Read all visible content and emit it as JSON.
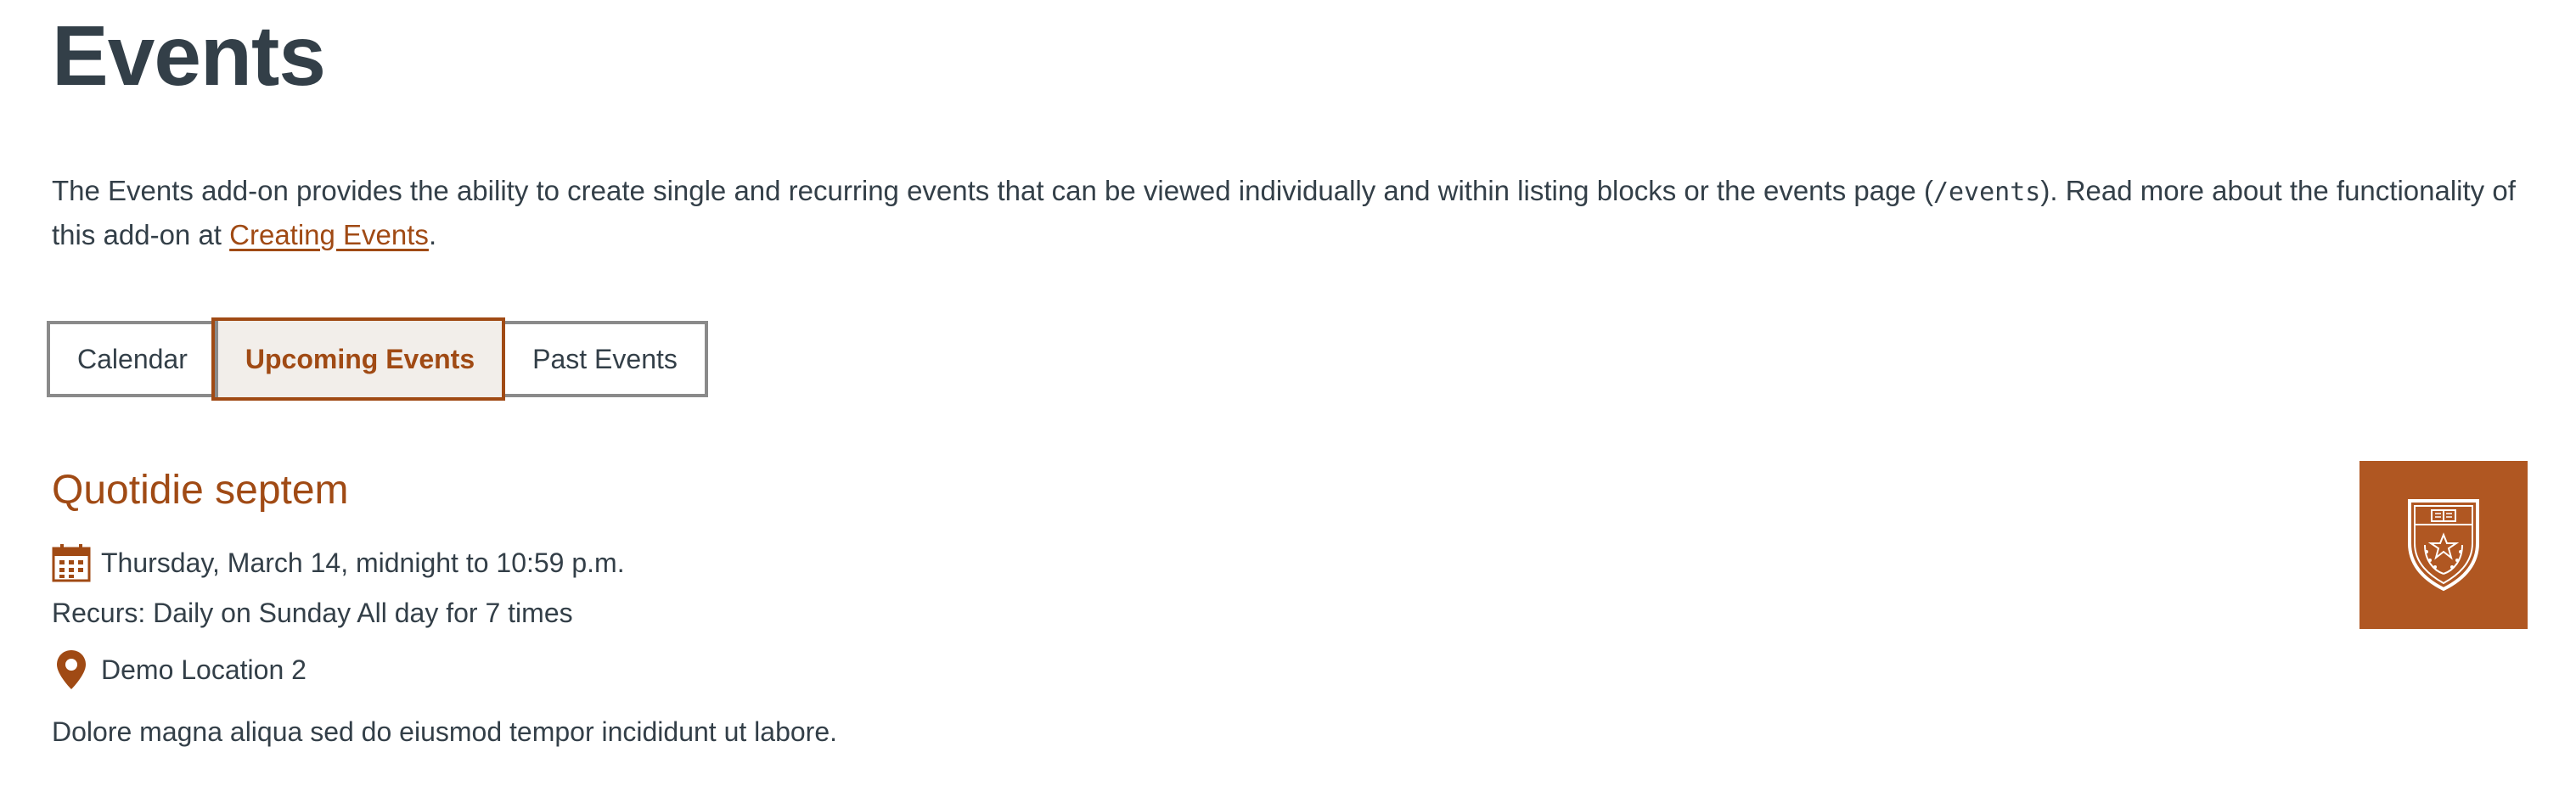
{
  "page": {
    "title": "Events"
  },
  "intro": {
    "text_before": "The Events add-on provides the ability to create single and recurring events that can be viewed individually and within listing blocks or the events page (",
    "code": "/events",
    "text_middle": "). Read more about the functionality of this add-on at ",
    "link_label": "Creating Events",
    "text_after": "."
  },
  "tabs": [
    {
      "label": "Calendar",
      "active": false
    },
    {
      "label": "Upcoming Events",
      "active": true
    },
    {
      "label": "Past Events",
      "active": false
    }
  ],
  "events": [
    {
      "title": "Quotidie septem",
      "date": "Thursday, March 14, midnight to 10:59 p.m.",
      "recurrence": "Recurs: Daily on Sunday All day for 7 times",
      "location": "Demo Location 2",
      "description": "Dolore magna aliqua sed do eiusmod tempor incididunt ut labore.",
      "date_icon": "calendar-icon",
      "location_icon": "map-pin-icon",
      "thumbnail": "university-seal-icon"
    }
  ],
  "colors": {
    "accent": "#a04a14",
    "thumbnail_bg": "#b05722",
    "text": "#333f48",
    "tab_border": "#8a8a8a",
    "tab_active_bg": "#f2eeea"
  }
}
